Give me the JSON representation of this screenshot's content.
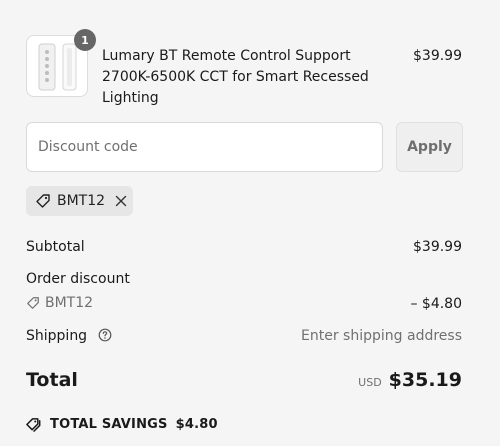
{
  "product": {
    "quantity": "1",
    "title": "Lumary BT Remote Control Support 2700K-6500K CCT for Smart Recessed Lighting",
    "price": "$39.99",
    "image_icon": "remote-control-product-image"
  },
  "discount": {
    "placeholder": "Discount code",
    "apply_label": "Apply",
    "applied_code": "BMT12"
  },
  "summary": {
    "subtotal_label": "Subtotal",
    "subtotal_value": "$39.99",
    "order_discount_label": "Order discount",
    "discount_code": "BMT12",
    "discount_value": "– $4.80",
    "shipping_label": "Shipping",
    "shipping_value": "Enter shipping address",
    "total_label": "Total",
    "currency": "USD",
    "total_value": "$35.19",
    "savings_label": "TOTAL SAVINGS",
    "savings_value": "$4.80"
  },
  "colors": {
    "background": "#f5f5f5",
    "badge": "#666666",
    "muted_text": "#707070",
    "chip": "#e6e6e6"
  }
}
